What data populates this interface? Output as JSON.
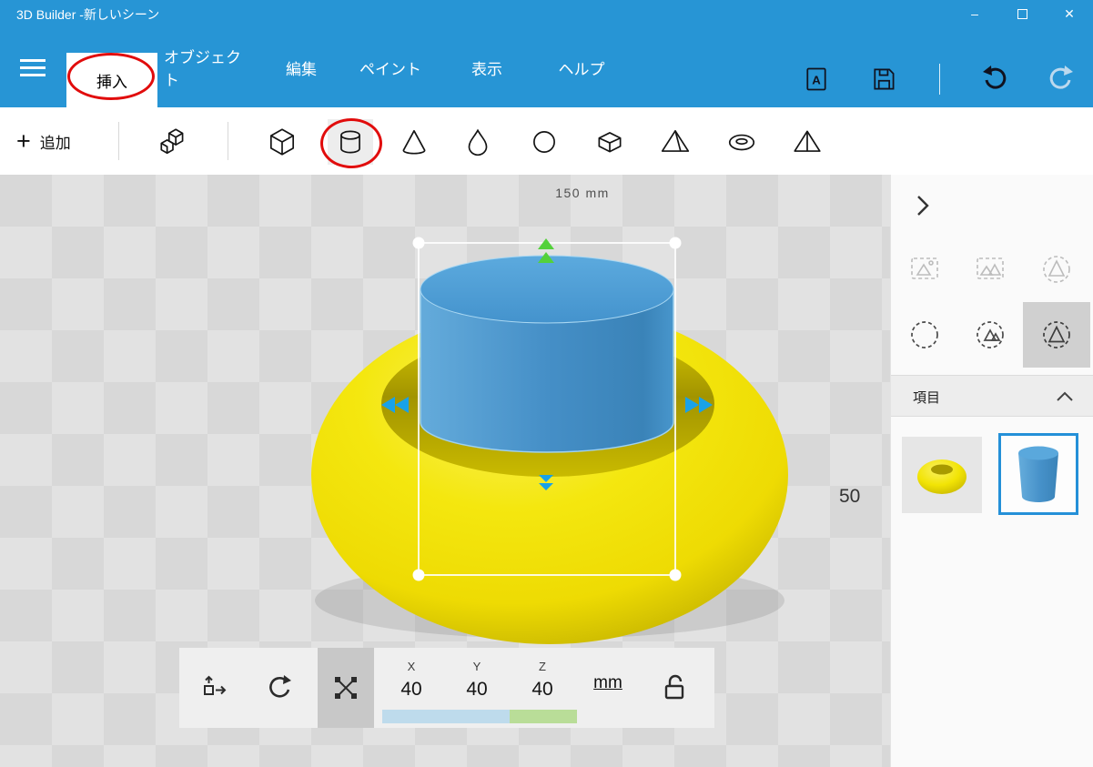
{
  "window": {
    "title": "3D Builder -新しいシーン",
    "minimize_glyph": "–",
    "close_glyph": "✕"
  },
  "menu": {
    "tabs": [
      {
        "label": "挿入",
        "selected": true
      },
      {
        "label": "オブジェクト",
        "selected": false
      },
      {
        "label": "編集",
        "selected": false
      },
      {
        "label": "ペイント",
        "selected": false
      },
      {
        "label": "表示",
        "selected": false
      },
      {
        "label": "ヘルプ",
        "selected": false
      }
    ],
    "selected_tab": "挿入"
  },
  "toolbar": {
    "plus_glyph": "+",
    "add_label": "追加",
    "shapes": [
      "cube",
      "cylinder",
      "cone",
      "teardrop",
      "sphere",
      "hexagonal-prism",
      "pyramid",
      "torus",
      "tetrahedron"
    ],
    "selected_shape": "cylinder"
  },
  "viewport": {
    "dim_top": "150 mm",
    "dim_right": "50",
    "objects": [
      "yellow-torus",
      "blue-cylinder"
    ],
    "selected_object": "blue-cylinder"
  },
  "transform_bar": {
    "axes": [
      {
        "label": "X",
        "value": "40"
      },
      {
        "label": "Y",
        "value": "40"
      },
      {
        "label": "Z",
        "value": "40"
      }
    ],
    "unit": "mm",
    "active_tool": "scale"
  },
  "right_panel": {
    "items_header": "項目",
    "items": [
      "torus",
      "cylinder"
    ],
    "selected_item": "cylinder"
  },
  "icons": {
    "hamburger": "three-bars",
    "print": "page-with-A",
    "save": "floppy-disk",
    "undo": "curved-arrow-left",
    "redo": "curved-arrow-right",
    "move": "square-with-arrow",
    "rotate": "circular-arrow",
    "scale": "cross-with-corner-handles",
    "lock": "open-padlock"
  },
  "annotations": {
    "circled": [
      "挿入-tab",
      "cylinder-shape-button"
    ]
  },
  "colors": {
    "title_blue": "#2795d5",
    "annotation_red": "#e10c0c",
    "torus_yellow": "#f2e405",
    "cylinder_blue": "#4695ce",
    "selection_white": "#ffffff",
    "arrow_green": "#54d13b",
    "arrow_blue": "#19a2e8",
    "selected_thumb_border": "#2490d8"
  }
}
